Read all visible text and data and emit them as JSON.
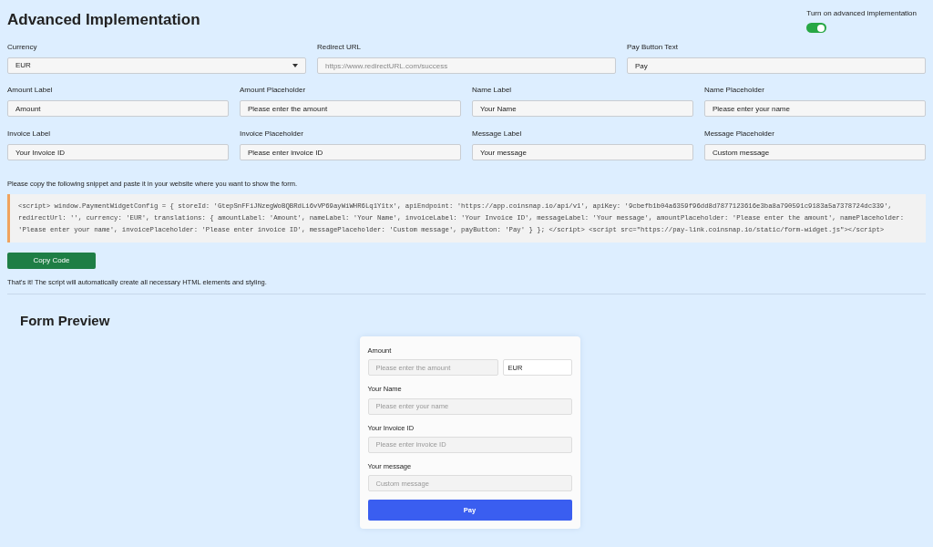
{
  "title": "Advanced Implementation",
  "toggle": {
    "label": "Turn on advanced implementation",
    "on": true
  },
  "top_fields": [
    {
      "kind": "select",
      "label": "Currency",
      "value": "EUR"
    },
    {
      "kind": "input",
      "label": "Redirect URL",
      "placeholder": "https://www.redirectURL.com/success"
    },
    {
      "kind": "input",
      "label": "Pay Button Text",
      "value": "Pay"
    }
  ],
  "fields": [
    {
      "label": "Amount Label",
      "value": "Amount"
    },
    {
      "label": "Amount Placeholder",
      "value": "Please enter the amount"
    },
    {
      "label": "Name Label",
      "value": "Your Name"
    },
    {
      "label": "Name Placeholder",
      "value": "Please enter your name"
    },
    {
      "label": "Invoice Label",
      "value": "Your Invoice ID"
    },
    {
      "label": "Invoice Placeholder",
      "value": "Please enter invoice ID"
    },
    {
      "label": "Message Label",
      "value": "Your message"
    },
    {
      "label": "Message Placeholder",
      "value": "Custom message"
    }
  ],
  "instructions": "Please copy the following snippet and paste it in your website where you want to show the form.",
  "code": "<script> window.PaymentWidgetConfig = { storeId: 'GtepSnFFiJNzegWoBQBRdLi6vVP69ayWiWHR6Lq1Y1tx', apiEndpoint: 'https://app.coinsnap.io/api/v1', apiKey: '9cbefb1b04a6359f96dd8d7877123616e3ba8a790591c9183a5a7378724dc339', redirectUrl: '', currency: 'EUR', translations: { amountLabel: 'Amount', nameLabel: 'Your Name', invoiceLabel: 'Your Invoice ID', messageLabel: 'Your message', amountPlaceholder: 'Please enter the amount', namePlaceholder: 'Please enter your name', invoicePlaceholder: 'Please enter invoice ID', messagePlaceholder: 'Custom message', payButton: 'Pay' } }; </script> <script src=\"https://pay-link.coinsnap.io/static/form-widget.js\"></script>",
  "copy_button": "Copy Code",
  "note": "That's it! The script will automatically create all necessary HTML elements and styling.",
  "preview": {
    "title": "Form Preview",
    "amount_label": "Amount",
    "amount_placeholder": "Please enter the amount",
    "currency": "EUR",
    "fields": [
      {
        "label": "Your Name",
        "placeholder": "Please enter your name"
      },
      {
        "label": "Your Invoice ID",
        "placeholder": "Please enter invoice ID"
      },
      {
        "label": "Your message",
        "placeholder": "Custom message"
      }
    ],
    "pay_button": "Pay"
  }
}
